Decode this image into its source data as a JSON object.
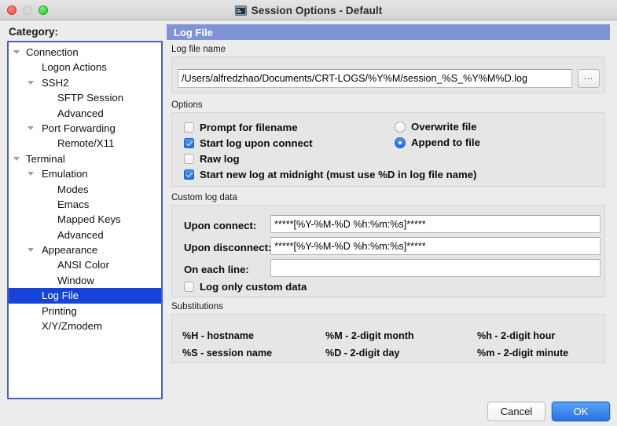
{
  "window": {
    "title": "Session Options - Default",
    "app_icon": "terminal-window-icon",
    "controls": {
      "close": "close",
      "minimize": "minimize",
      "maximize": "maximize"
    }
  },
  "sidebar": {
    "label": "Category:",
    "items": [
      {
        "label": "Connection",
        "depth": 0,
        "twisty": true,
        "selected": false
      },
      {
        "label": "Logon Actions",
        "depth": 1,
        "twisty": false,
        "selected": false
      },
      {
        "label": "SSH2",
        "depth": 1,
        "twisty": true,
        "selected": false
      },
      {
        "label": "SFTP Session",
        "depth": 2,
        "twisty": false,
        "selected": false
      },
      {
        "label": "Advanced",
        "depth": 2,
        "twisty": false,
        "selected": false
      },
      {
        "label": "Port Forwarding",
        "depth": 1,
        "twisty": true,
        "selected": false
      },
      {
        "label": "Remote/X11",
        "depth": 2,
        "twisty": false,
        "selected": false
      },
      {
        "label": "Terminal",
        "depth": 0,
        "twisty": true,
        "selected": false
      },
      {
        "label": "Emulation",
        "depth": 1,
        "twisty": true,
        "selected": false
      },
      {
        "label": "Modes",
        "depth": 2,
        "twisty": false,
        "selected": false
      },
      {
        "label": "Emacs",
        "depth": 2,
        "twisty": false,
        "selected": false
      },
      {
        "label": "Mapped Keys",
        "depth": 2,
        "twisty": false,
        "selected": false
      },
      {
        "label": "Advanced",
        "depth": 2,
        "twisty": false,
        "selected": false
      },
      {
        "label": "Appearance",
        "depth": 1,
        "twisty": true,
        "selected": false
      },
      {
        "label": "ANSI Color",
        "depth": 2,
        "twisty": false,
        "selected": false
      },
      {
        "label": "Window",
        "depth": 2,
        "twisty": false,
        "selected": false
      },
      {
        "label": "Log File",
        "depth": 1,
        "twisty": false,
        "selected": true
      },
      {
        "label": "Printing",
        "depth": 1,
        "twisty": false,
        "selected": false
      },
      {
        "label": "X/Y/Zmodem",
        "depth": 1,
        "twisty": false,
        "selected": false
      }
    ]
  },
  "pane": {
    "header": "Log File",
    "logfile": {
      "group_title": "Log file name",
      "value": "/Users/alfredzhao/Documents/CRT-LOGS/%Y%M/session_%S_%Y%M%D.log",
      "browse_label": "..."
    },
    "options": {
      "group_title": "Options",
      "checkboxes": [
        {
          "label": "Prompt for filename",
          "checked": false
        },
        {
          "label": "Start log upon connect",
          "checked": true
        },
        {
          "label": "Raw log",
          "checked": false
        },
        {
          "label": "Start new log at midnight (must use %D in log file name)",
          "checked": true
        }
      ],
      "radios": [
        {
          "label": "Overwrite file",
          "selected": false
        },
        {
          "label": "Append to file",
          "selected": true
        }
      ]
    },
    "custom": {
      "group_title": "Custom log data",
      "fields": [
        {
          "label": "Upon connect:",
          "value": "*****[%Y-%M-%D %h:%m:%s]*****"
        },
        {
          "label": "Upon disconnect:",
          "value": "*****[%Y-%M-%D %h:%m:%s]*****"
        },
        {
          "label": "On each line:",
          "value": ""
        }
      ],
      "checkbox": {
        "label": "Log only custom data",
        "checked": false
      }
    },
    "substitutions": {
      "group_title": "Substitutions",
      "entries": [
        "%H - hostname",
        "%M - 2-digit month",
        "%h - 2-digit hour",
        "%S - session name",
        "%D - 2-digit day",
        "%m - 2-digit minute"
      ]
    }
  },
  "footer": {
    "cancel": "Cancel",
    "ok": "OK"
  },
  "colors": {
    "pane_header": "#7f93d9",
    "tree_selection": "#1744d8",
    "accent_button": "#2a70e8",
    "checkbox_on": "#1f6fe0"
  }
}
